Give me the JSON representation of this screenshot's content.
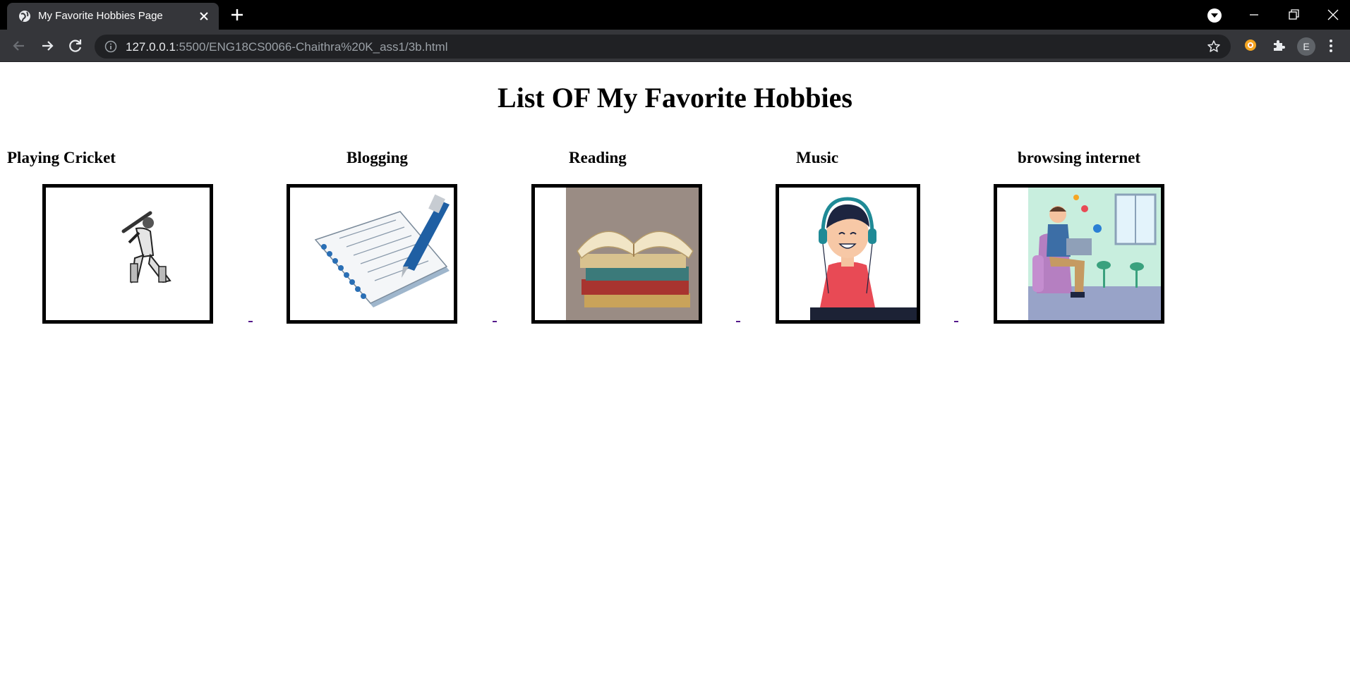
{
  "browser": {
    "tab_title": "My Favorite Hobbies Page",
    "url_host": "127.0.0.1",
    "url_rest": ":5500/ENG18CS0066-Chaithra%20K_ass1/3b.html",
    "profile_initial": "E",
    "icons": {
      "tab_favicon": "globe-icon",
      "tab_close": "close-icon",
      "new_tab": "plus-icon",
      "back": "back-arrow-icon",
      "forward": "forward-arrow-icon",
      "reload": "reload-icon",
      "site_info": "info-icon",
      "bookmark": "star-icon",
      "extension_1": "extension-orange-icon",
      "extensions": "puzzle-icon",
      "menu": "kebab-menu-icon",
      "minimize": "minimize-icon",
      "restore": "restore-icon",
      "close_window": "close-window-icon",
      "profile_dropdown": "chevron-down-icon"
    }
  },
  "page": {
    "heading": "List OF My Favorite Hobbies",
    "hobbies": [
      {
        "name": "Playing Cricket",
        "image": "cricket-batsman-image"
      },
      {
        "name": "Blogging",
        "image": "notebook-pen-image"
      },
      {
        "name": "Reading",
        "image": "stack-of-books-image"
      },
      {
        "name": "Music",
        "image": "boy-with-headphones-image"
      },
      {
        "name": "browsing internet",
        "image": "man-with-laptop-image"
      }
    ],
    "colors": {
      "link_visited": "#551a8b",
      "chrome_dark": "#35363a",
      "tabbar": "#000000"
    }
  }
}
